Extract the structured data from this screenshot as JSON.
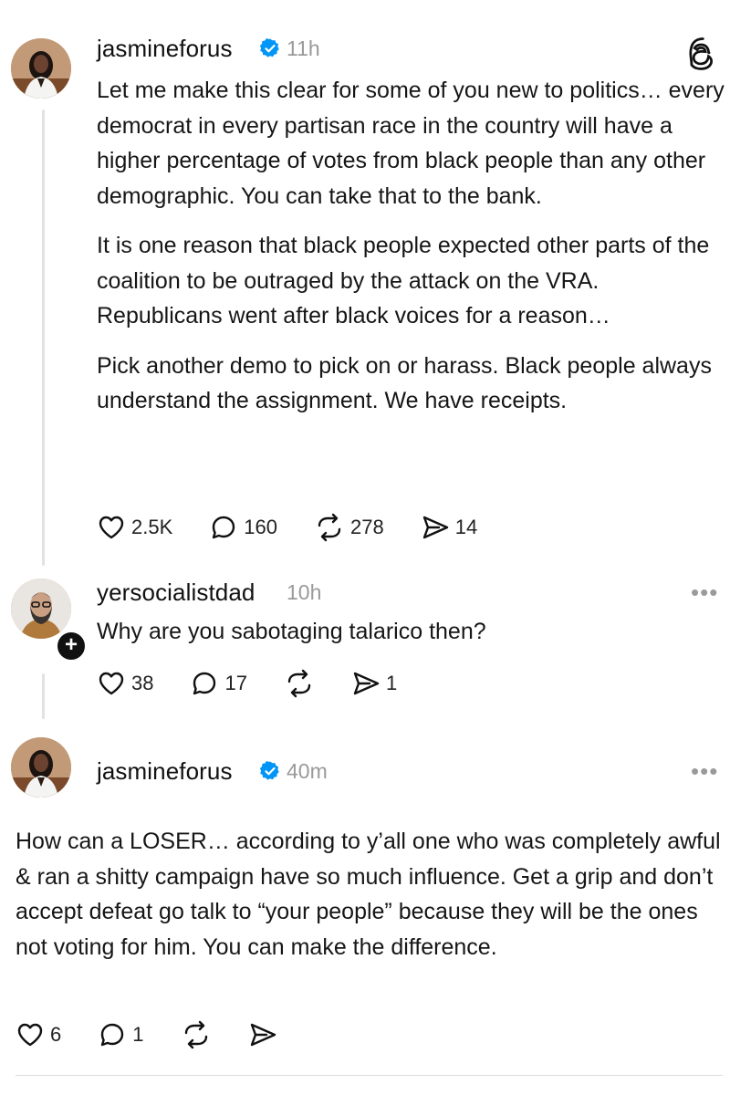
{
  "posts": [
    {
      "username": "jasmineforus",
      "verified": true,
      "time": "11h",
      "paragraphs": [
        "Let me make this clear for some of you new to politics… every democrat in every partisan race in the country will have a higher percentage of votes from black people than any other demographic. You can take that to the bank.",
        "It is one reason that black people expected other parts of the coalition to be outraged by the attack on the VRA. Republicans went after black voices for a reason…",
        "Pick another demo to pick on or harass. Black people always understand the assignment. We have receipts."
      ],
      "likes": "2.5K",
      "replies": "160",
      "reposts": "278",
      "shares": "14"
    },
    {
      "username": "yersocialistdad",
      "verified": false,
      "time": "10h",
      "text": "Why are you sabotaging talarico then?",
      "likes": "38",
      "replies": "17",
      "reposts": "",
      "shares": "1"
    },
    {
      "username": "jasmineforus",
      "verified": true,
      "time": "40m",
      "text": "How can a LOSER… according to y’all one who was completely awful & ran a shitty campaign have so much influence. Get a grip and don’t accept defeat go talk to “your people” because  they will be the ones not voting for him. You can make the difference.",
      "likes": "6",
      "replies": "1",
      "reposts": "",
      "shares": ""
    }
  ],
  "icons": {
    "app_logo": "threads-logo-icon",
    "verified": "verified-badge-icon",
    "like": "heart-icon",
    "reply": "comment-icon",
    "repost": "repost-icon",
    "share": "share-icon",
    "more": "more-options-icon"
  },
  "colors": {
    "verified_blue": "#0095f6",
    "muted_text": "#9a9a9a",
    "thread_line": "#e2e2e2"
  }
}
